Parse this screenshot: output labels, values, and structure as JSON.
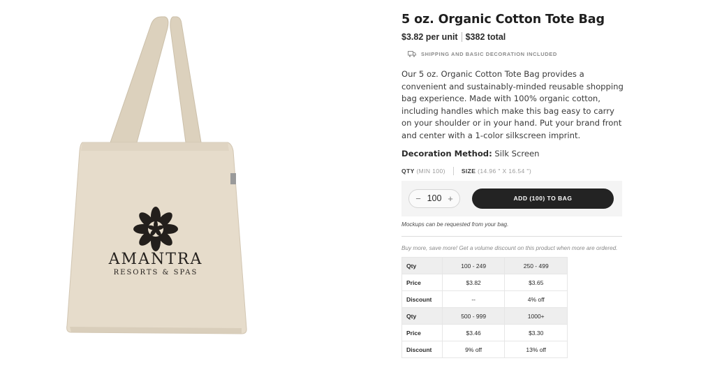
{
  "product": {
    "title": "5 oz. Organic Cotton Tote Bag",
    "unit_price": "$3.82 per unit",
    "total_price": "$382 total",
    "shipping_text": "SHIPPING AND BASIC DECORATION INCLUDED",
    "shipping_icon": "truck-icon",
    "description": "Our 5 oz. Organic Cotton Tote Bag provides a convenient and sustainably-minded reusable shopping bag experience. Made with 100% organic cotton, including handles which make this bag easy to carry on your shoulder or in your hand. Put your brand front and center with a 1-color silkscreen imprint.",
    "decoration_label": "Decoration Method:",
    "decoration_value": "Silk Screen",
    "image": {
      "brand_name": "AMANTRA",
      "brand_tagline": "RESORTS & SPAS"
    }
  },
  "order": {
    "qty_label": "QTY",
    "qty_min": "(MIN 100)",
    "size_label": "SIZE",
    "size_value": "(14.96 \" X 16.54 \")",
    "quantity": "100",
    "decrement": "−",
    "increment": "+",
    "add_button_label": "ADD (100) TO BAG",
    "mockup_note": "Mockups can be requested from your bag."
  },
  "volume": {
    "note": "Buy more, save more! Get a volume discount on this product when more are ordered.",
    "rows": [
      [
        "Qty",
        "100 - 249",
        "250 - 499"
      ],
      [
        "Price",
        "$3.82",
        "$3.65"
      ],
      [
        "Discount",
        "--",
        "4% off"
      ],
      [
        "Qty",
        "500 - 999",
        "1000+"
      ],
      [
        "Price",
        "$3.46",
        "$3.30"
      ],
      [
        "Discount",
        "9% off",
        "13% off"
      ]
    ]
  },
  "colors": {
    "button_dark": "#232323",
    "bag_canvas": "#e6dccb",
    "header_row_bg": "#eeeeee"
  }
}
